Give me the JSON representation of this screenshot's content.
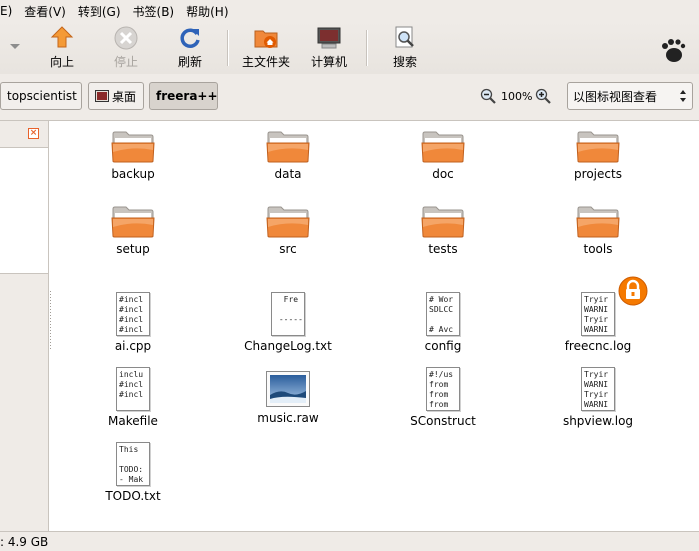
{
  "menu": [
    "E)",
    "查看(V)",
    "转到(G)",
    "书签(B)",
    "帮助(H)"
  ],
  "toolbar": {
    "up": "向上",
    "stop": "停止",
    "refresh": "刷新",
    "home": "主文件夹",
    "computer": "计算机",
    "search": "搜索"
  },
  "location": {
    "crumbs": [
      "topscientist",
      "桌面",
      "freera++"
    ],
    "zoom_level": "100%",
    "view_mode": "以图标视图查看"
  },
  "files": {
    "folders": [
      "backup",
      "data",
      "doc",
      "projects",
      "setup",
      "src",
      "tests",
      "tools"
    ],
    "documents": [
      {
        "name": "ai.cpp",
        "preview": "#incl\n#incl\n#incl\n#incl"
      },
      {
        "name": "ChangeLog.txt",
        "preview": "  Fre\n\n -----"
      },
      {
        "name": "config",
        "preview": "# Wor\nSDLCC\n\n# Avc"
      },
      {
        "name": "freecnc.log",
        "preview": "Tryir\nWARNI\nTryir\nWARNI",
        "locked": true
      },
      {
        "name": "Makefile",
        "preview": "inclu\n#incl\n#incl"
      },
      {
        "name": "music.raw",
        "preview": ""
      },
      {
        "name": "SConstruct",
        "preview": "#!/us\nfrom\nfrom\nfrom"
      },
      {
        "name": "shpview.log",
        "preview": "Tryir\nWARNI\nTryir\nWARNI"
      },
      {
        "name": "TODO.txt",
        "preview": "This\n\nTODO:\n- Mak"
      }
    ]
  },
  "status": ": 4.9 GB",
  "colors": {
    "folder_orange": "#f0883a",
    "lock_orange": "#f57900",
    "chrome": "#efebe7"
  }
}
